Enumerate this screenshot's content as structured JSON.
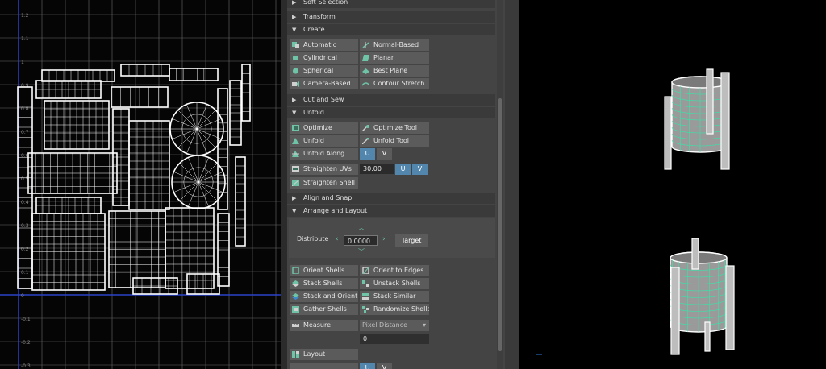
{
  "uv_editor": {
    "v_ticks": [
      "1.2",
      "1.1",
      "1",
      "0.9",
      "0.8",
      "0.7",
      "0.6",
      "0.5",
      "0.4",
      "0.3",
      "0.2",
      "0.1",
      "0",
      "-0.1",
      "-0.2",
      "-0.3"
    ],
    "grid_color": "#6a6a6a",
    "axis_color": "#2c43c9"
  },
  "toolkit": {
    "soft_selection": "Soft Selection",
    "transform": "Transform",
    "create": {
      "title": "Create",
      "buttons": [
        "Automatic",
        "Normal-Based",
        "Cylindrical",
        "Planar",
        "Spherical",
        "Best Plane",
        "Camera-Based",
        "Contour Stretch"
      ]
    },
    "cut_and_sew": "Cut and Sew",
    "unfold": {
      "title": "Unfold",
      "optimize": "Optimize",
      "optimize_tool": "Optimize Tool",
      "unfold": "Unfold",
      "unfold_tool": "Unfold Tool",
      "unfold_along": "Unfold Along",
      "u": "U",
      "v": "V",
      "straighten_uvs": "Straighten UVs",
      "straighten_value": "30.00",
      "straighten_shell": "Straighten Shell"
    },
    "align_and_snap": "Align and Snap",
    "arrange_and_layout": {
      "title": "Arrange and Layout",
      "distribute": "Distribute",
      "distribute_value": "0.0000",
      "target": "Target",
      "buttons": [
        "Orient Shells",
        "Orient to Edges",
        "Stack Shells",
        "Unstack Shells",
        "Stack and Orient",
        "Stack Similar",
        "Gather Shells",
        "Randomize Shells"
      ],
      "measure": "Measure",
      "measure_option": "Pixel Distance",
      "measure_value": "0",
      "layout": "Layout"
    }
  },
  "viewport": {
    "wire_color": "#36e6a8",
    "mesh_fill": "#9a9a9a"
  }
}
